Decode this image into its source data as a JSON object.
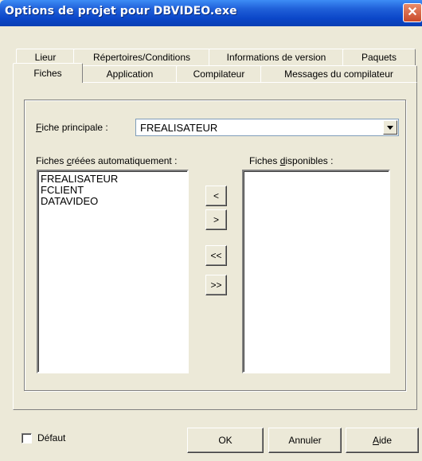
{
  "window": {
    "title": "Options de projet pour DBVIDEO.exe",
    "close_glyph": "✕"
  },
  "tabs_back": [
    "Lieur",
    "Répertoires/Conditions",
    "Informations de version",
    "Paquets"
  ],
  "tabs_front": [
    "Fiches",
    "Application",
    "Compilateur",
    "Messages du compilateur"
  ],
  "main_form": {
    "label_first": "F",
    "label_rest": "iche principale :",
    "value": "FREALISATEUR"
  },
  "auto_forms": {
    "label_before": "Fiches ",
    "label_u": "c",
    "label_after": "réées automatiquement :",
    "items": [
      "FREALISATEUR",
      "FCLIENT",
      "DATAVIDEO"
    ]
  },
  "available_forms": {
    "label_before": "Fiches ",
    "label_u": "d",
    "label_after": "isponibles :",
    "items": []
  },
  "move_buttons": {
    "move_left": "<",
    "move_right": ">",
    "move_all_left": "<<",
    "move_all_right": ">>"
  },
  "footer": {
    "default_label": "Défaut",
    "default_checked": false,
    "ok_label": "OK",
    "cancel_label": "Annuler",
    "help_first": "A",
    "help_rest": "ide"
  }
}
